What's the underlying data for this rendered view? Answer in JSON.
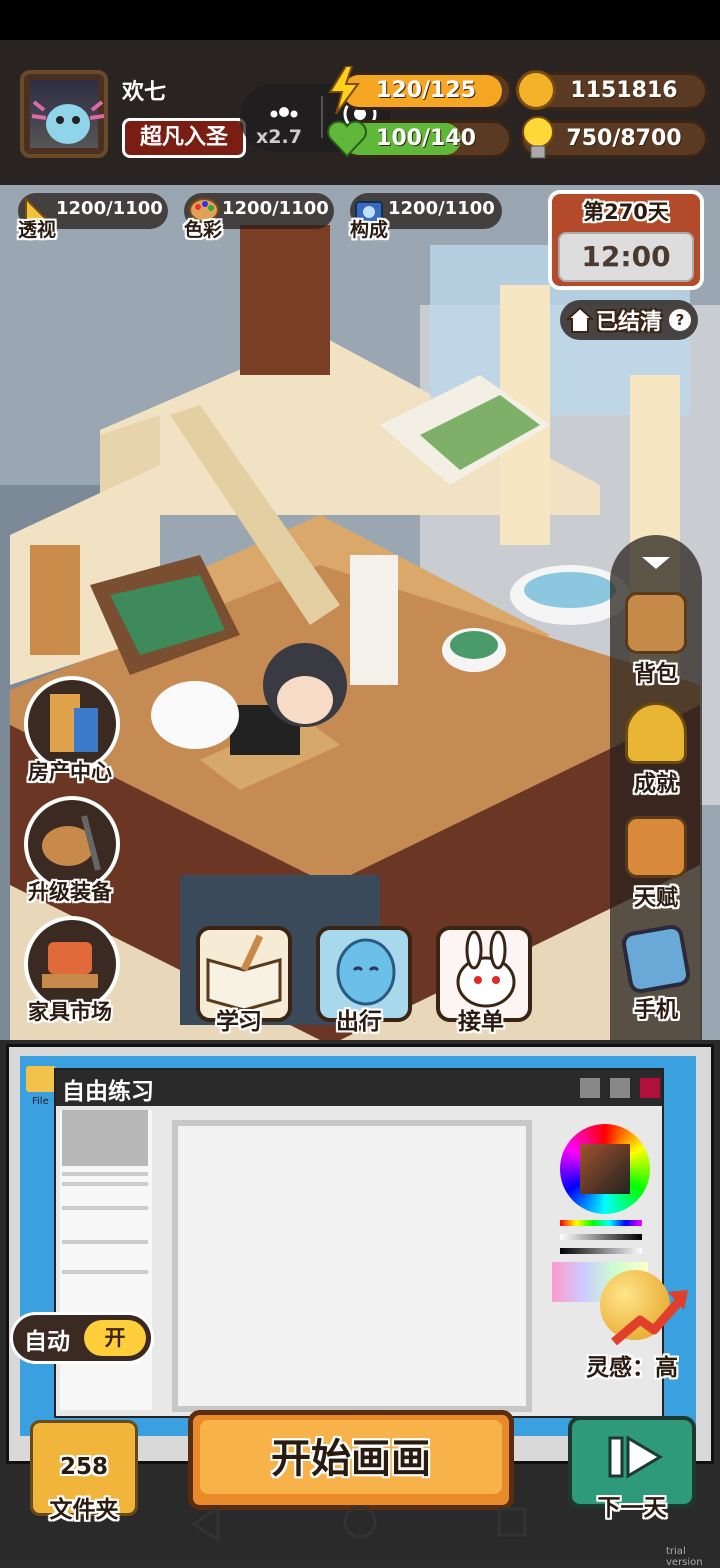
{
  "player": {
    "name": "欢七",
    "title": "超凡入圣",
    "speed_multiplier": "x2.7"
  },
  "resources": {
    "energy": "120/125",
    "energy_fill": 0.96,
    "coins": "1151816",
    "health": "100/140",
    "health_fill": 0.71,
    "inspiration_points": "750/8700"
  },
  "skills": [
    {
      "value": "1200/1100",
      "label": "透视",
      "icon": "ruler-icon"
    },
    {
      "value": "1200/1100",
      "label": "色彩",
      "icon": "palette-icon"
    },
    {
      "value": "1200/1100",
      "label": "构成",
      "icon": "camera-icon"
    }
  ],
  "calendar": {
    "day": "第270天",
    "time": "12:00",
    "status": "已结清"
  },
  "left_menu": [
    {
      "label": "房产中心",
      "icon": "building-icon"
    },
    {
      "label": "升级装备",
      "icon": "paint-brush-icon"
    },
    {
      "label": "家具市场",
      "icon": "tv-desk-icon"
    }
  ],
  "bottom_menu": [
    {
      "label": "学习",
      "icon": "book-icon"
    },
    {
      "label": "出行",
      "icon": "blue-ghost-icon"
    },
    {
      "label": "接单",
      "icon": "bunny-icon"
    }
  ],
  "right_menu": [
    {
      "label": "背包",
      "icon": "backpack-icon"
    },
    {
      "label": "成就",
      "icon": "trophy-icon"
    },
    {
      "label": "天赋",
      "icon": "talent-book-icon"
    },
    {
      "label": "手机",
      "icon": "phone-icon"
    }
  ],
  "practice": {
    "window_title": "自由练习",
    "auto_label": "自动",
    "auto_state": "开",
    "inspiration": "灵感：高",
    "folder_count": "258",
    "folder_label": "文件夹",
    "start_label": "开始画画",
    "next_label": "下一天"
  },
  "misc": {
    "file_menu": "File",
    "trial": "trial version"
  },
  "colors": {
    "energy_bar": "#f5a623",
    "health_bar": "#5fb83a",
    "calendar": "#b34a2a",
    "start_button": "#e98a2a",
    "next_button": "#2f9a7a"
  }
}
